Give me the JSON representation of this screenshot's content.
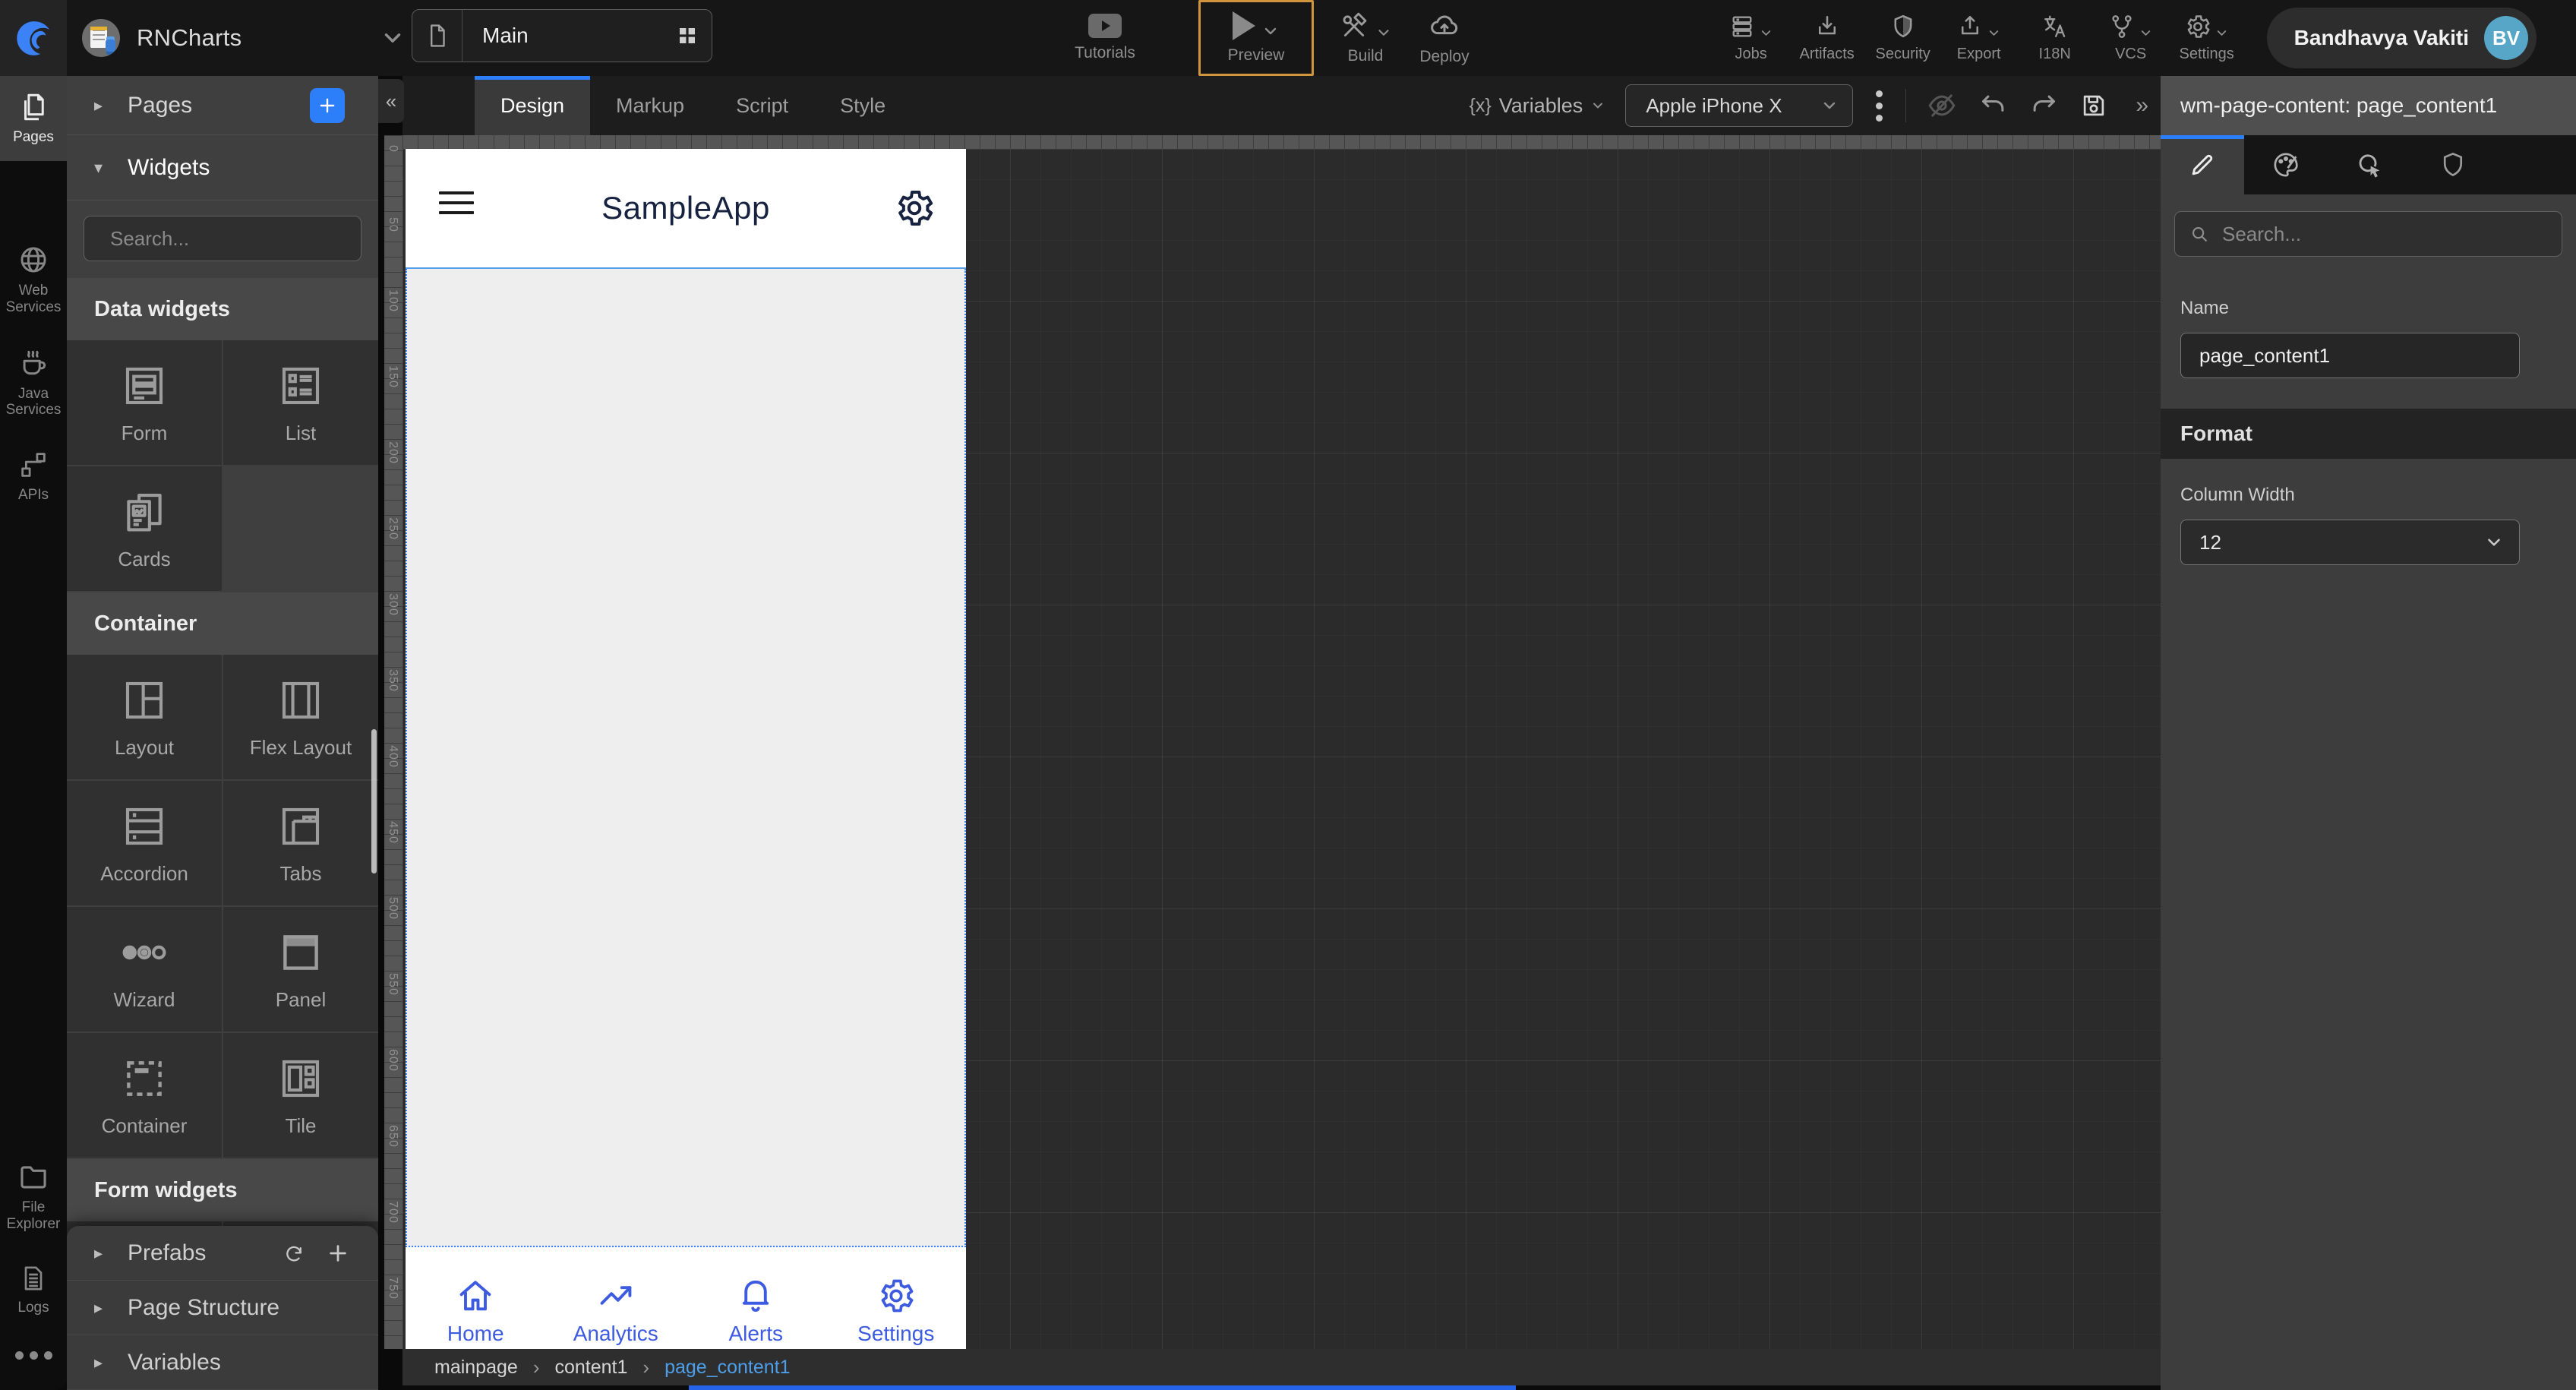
{
  "header": {
    "project_name": "RNCharts",
    "page_tab": "Main",
    "tutorials_label": "Tutorials",
    "preview_label": "Preview",
    "build_label": "Build",
    "deploy_label": "Deploy",
    "menu_items": [
      {
        "label": "Jobs",
        "icon": "jobs-icon",
        "has_chevron": true
      },
      {
        "label": "Artifacts",
        "icon": "artifacts-icon",
        "has_chevron": false
      },
      {
        "label": "Security",
        "icon": "security-icon",
        "has_chevron": false
      },
      {
        "label": "Export",
        "icon": "export-icon",
        "has_chevron": true
      },
      {
        "label": "I18N",
        "icon": "i18n-icon",
        "has_chevron": false
      },
      {
        "label": "VCS",
        "icon": "vcs-icon",
        "has_chevron": true
      },
      {
        "label": "Settings",
        "icon": "settings-icon",
        "has_chevron": true
      }
    ],
    "user": {
      "name": "Bandhavya Vakiti",
      "initials": "BV"
    }
  },
  "toolbar": {
    "tabs": [
      {
        "label": "Design",
        "active": true
      },
      {
        "label": "Markup",
        "active": false
      },
      {
        "label": "Script",
        "active": false
      },
      {
        "label": "Style",
        "active": false
      }
    ],
    "variables_prefix": "{x}",
    "variables_label": "Variables",
    "device_selector_value": "Apple iPhone X"
  },
  "left_rail": {
    "items": [
      {
        "label": "Pages",
        "icon": "pages-icon",
        "active": true
      },
      {
        "label": "Web Services",
        "icon": "globe-icon",
        "active": false
      },
      {
        "label": "Java Services",
        "icon": "coffee-icon",
        "active": false
      },
      {
        "label": "APIs",
        "icon": "api-nodes-icon",
        "active": false
      },
      {
        "label": "File Explorer",
        "icon": "folder-icon",
        "active": false
      },
      {
        "label": "Logs",
        "icon": "log-file-icon",
        "active": false
      }
    ]
  },
  "left_panel": {
    "pages_label": "Pages",
    "widgets_label": "Widgets",
    "search_placeholder": "Search...",
    "sections": [
      {
        "title": "Data widgets",
        "tiles": [
          {
            "label": "Form"
          },
          {
            "label": "List"
          },
          {
            "label": "Cards"
          }
        ]
      },
      {
        "title": "Container",
        "tiles": [
          {
            "label": "Layout"
          },
          {
            "label": "Flex Layout"
          },
          {
            "label": "Accordion"
          },
          {
            "label": "Tabs"
          },
          {
            "label": "Wizard"
          },
          {
            "label": "Panel"
          },
          {
            "label": "Container"
          },
          {
            "label": "Tile"
          }
        ]
      },
      {
        "title": "Form widgets",
        "tiles": []
      }
    ],
    "collapsed_sections": [
      {
        "label": "Prefabs"
      },
      {
        "label": "Page Structure"
      },
      {
        "label": "Variables"
      }
    ]
  },
  "canvas": {
    "device": {
      "app_title": "SampleApp",
      "nav_items": [
        {
          "label": "Home",
          "icon": "home-icon"
        },
        {
          "label": "Analytics",
          "icon": "trend-icon"
        },
        {
          "label": "Alerts",
          "icon": "bell-icon"
        },
        {
          "label": "Settings",
          "icon": "gear-icon"
        }
      ]
    },
    "breadcrumb": [
      {
        "label": "mainpage",
        "active": false
      },
      {
        "label": "content1",
        "active": false
      },
      {
        "label": "page_content1",
        "active": true
      }
    ],
    "ruler": {
      "values": [
        0,
        50,
        100,
        150,
        200,
        250,
        300,
        350,
        400,
        450,
        500,
        550,
        600,
        650,
        700,
        750
      ]
    }
  },
  "right_panel": {
    "title": "wm-page-content: page_content1",
    "search_placeholder": "Search...",
    "name_label": "Name",
    "name_value": "page_content1",
    "format_section_label": "Format",
    "column_width_label": "Column Width",
    "column_width_value": "12"
  },
  "colors": {
    "accent_blue": "#2d7ff9",
    "selection_blue": "#4a90e2",
    "phone_nav_blue": "#3d5be0",
    "breadcrumb_active_blue": "#4d9fec",
    "preview_highlight_orange": "#d2953f",
    "avatar_teal": "#57a6c8"
  }
}
